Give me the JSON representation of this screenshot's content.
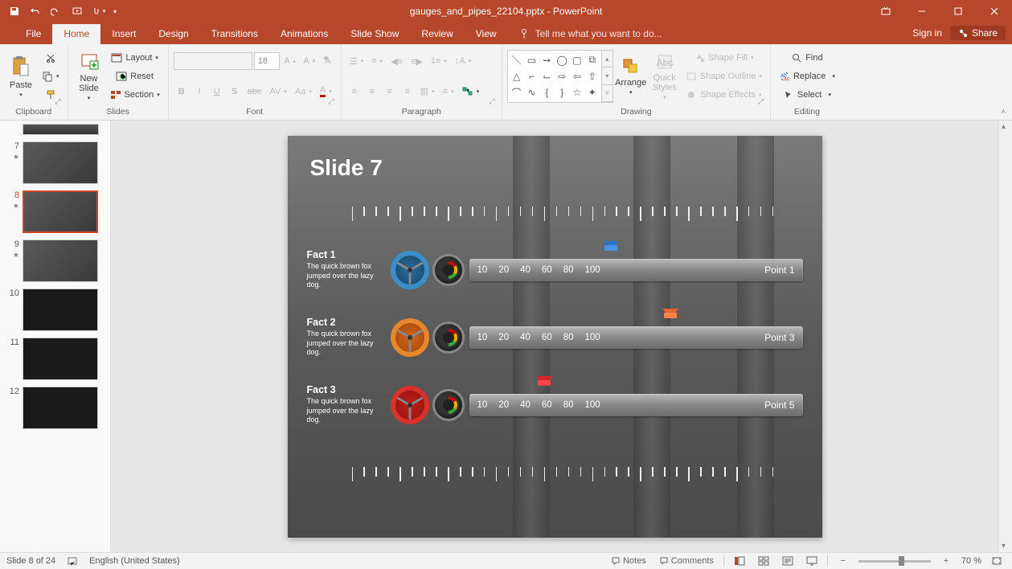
{
  "title": {
    "filename": "gauges_and_pipes_22104.pptx",
    "app": "PowerPoint"
  },
  "menu": {
    "file": "File",
    "home": "Home",
    "insert": "Insert",
    "design": "Design",
    "transitions": "Transitions",
    "animations": "Animations",
    "slideshow": "Slide Show",
    "review": "Review",
    "view": "View",
    "tell_me": "Tell me what you want to do...",
    "sign_in": "Sign in",
    "share": "Share"
  },
  "ribbon": {
    "clipboard": {
      "label": "Clipboard",
      "paste": "Paste"
    },
    "slides": {
      "label": "Slides",
      "new_slide": "New\nSlide",
      "layout": "Layout",
      "reset": "Reset",
      "section": "Section"
    },
    "font": {
      "label": "Font",
      "size": "18"
    },
    "paragraph": {
      "label": "Paragraph"
    },
    "drawing": {
      "label": "Drawing",
      "arrange": "Arrange",
      "quick_styles": "Quick\nStyles",
      "shape_fill": "Shape Fill",
      "shape_outline": "Shape Outline",
      "shape_effects": "Shape Effects"
    },
    "editing": {
      "label": "Editing",
      "find": "Find",
      "replace": "Replace",
      "select": "Select"
    }
  },
  "thumbs": [
    {
      "n": "7",
      "star": true
    },
    {
      "n": "8",
      "star": true,
      "selected": true
    },
    {
      "n": "9",
      "star": true
    },
    {
      "n": "10"
    },
    {
      "n": "11"
    },
    {
      "n": "12"
    }
  ],
  "slide": {
    "title": "Slide 7",
    "scale": [
      "10",
      "20",
      "40",
      "60",
      "80",
      "100"
    ],
    "rows": [
      {
        "fact": "Fact 1",
        "body": "The quick brown fox jumped over the lazy dog.",
        "point": "Point 1",
        "color": "blue",
        "arrow_pct": 40
      },
      {
        "fact": "Fact 2",
        "body": "The quick brown fox jumped over the lazy dog.",
        "point": "Point 3",
        "color": "orange",
        "arrow_pct": 58
      },
      {
        "fact": "Fact 3",
        "body": "The quick brown fox jumped over the lazy dog.",
        "point": "Point 5",
        "color": "red",
        "arrow_pct": 20
      }
    ]
  },
  "status": {
    "slide_pos": "Slide 8 of 24",
    "lang": "English (United States)",
    "notes": "Notes",
    "comments": "Comments",
    "zoom": "70 %"
  }
}
